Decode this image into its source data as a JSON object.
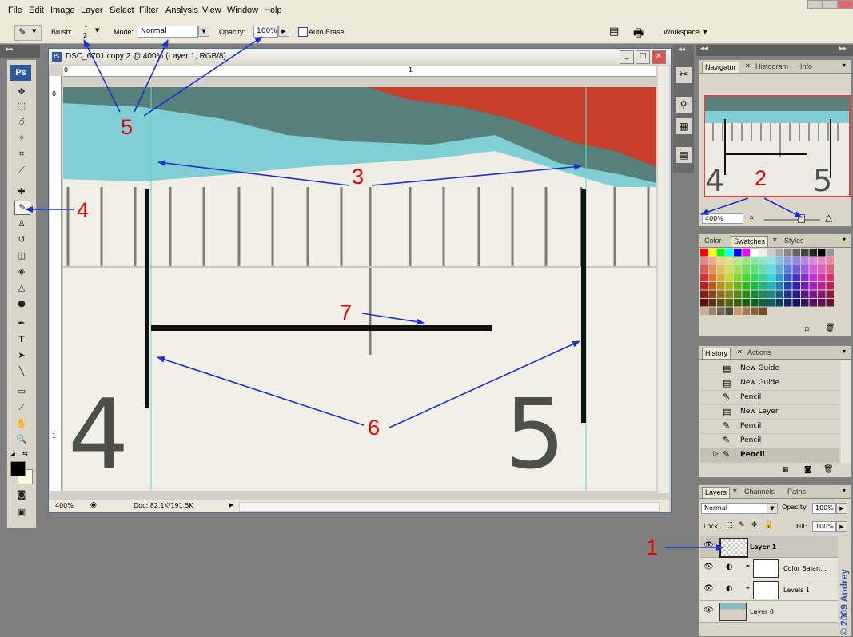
{
  "menu": [
    "File",
    "Edit",
    "Image",
    "Layer",
    "Select",
    "Filter",
    "Analysis",
    "View",
    "Window",
    "Help"
  ],
  "options": {
    "brush_label": "Brush:",
    "brush_size": "2",
    "mode_label": "Mode:",
    "mode_value": "Normal",
    "opacity_label": "Opacity:",
    "opacity_value": "100%",
    "auto_erase": "Auto Erase",
    "workspace": "Workspace ▼"
  },
  "toolbox": {
    "logo": "Ps"
  },
  "document": {
    "title": "DSC_6701 copy 2 @ 400% (Layer 1, RGB/8)",
    "ruler_h": [
      "0",
      "1"
    ],
    "ruler_v": [
      "0",
      "1"
    ],
    "zoom": "400%",
    "doc_info": "Doc: 82,1K/191,5K"
  },
  "canvas": {
    "digit_left": "4",
    "digit_right": "5"
  },
  "navigator": {
    "tabs": [
      "Navigator",
      "Histogram",
      "Info"
    ],
    "zoom": "400%",
    "digit_left": "4",
    "digit_right": "5"
  },
  "swatches": {
    "tabs": [
      "Color",
      "Swatches",
      "Styles"
    ]
  },
  "history": {
    "tabs": [
      "History",
      "Actions"
    ],
    "items": [
      "New Guide",
      "New Guide",
      "Pencil",
      "New Layer",
      "Pencil",
      "Pencil",
      "Pencil"
    ]
  },
  "layers": {
    "tabs": [
      "Layers",
      "Channels",
      "Paths"
    ],
    "blend": "Normal",
    "opacity_label": "Opacity:",
    "opacity": "100%",
    "lock_label": "Lock:",
    "fill_label": "Fill:",
    "fill": "100%",
    "items": [
      "Layer 1",
      "Color Balan...",
      "Levels 1",
      "Layer 0"
    ]
  },
  "annotations": [
    "1",
    "2",
    "3",
    "4",
    "5",
    "6",
    "7"
  ],
  "watermark": "© 2009 Andrey"
}
